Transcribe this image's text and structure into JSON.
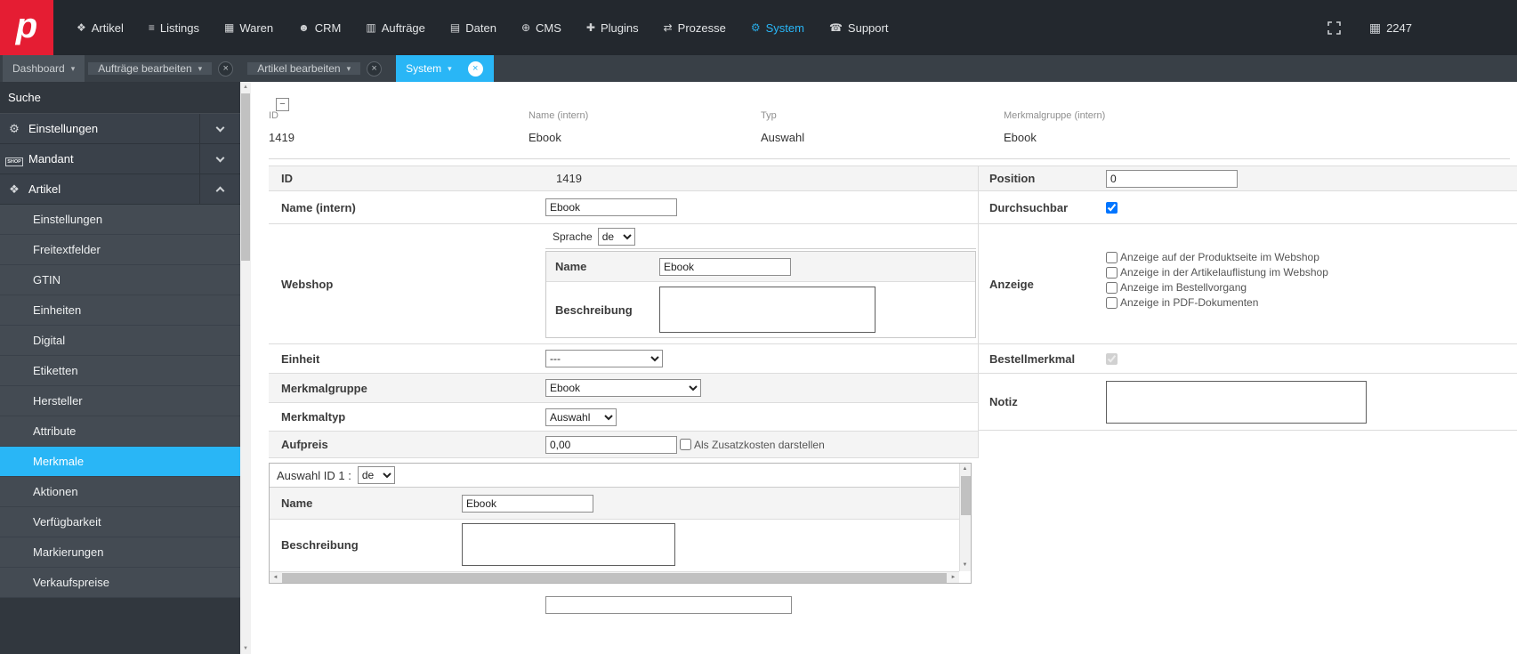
{
  "colors": {
    "accent": "#29b6f6",
    "logo_red": "#e51d33",
    "nav_bg": "#23282e"
  },
  "topnav": {
    "logo_letter": "p",
    "counter": "2247",
    "items": [
      {
        "label": "Artikel",
        "glyph": "❖"
      },
      {
        "label": "Listings",
        "glyph": "≡"
      },
      {
        "label": "Waren",
        "glyph": "▦"
      },
      {
        "label": "CRM",
        "glyph": "☻"
      },
      {
        "label": "Aufträge",
        "glyph": "▥"
      },
      {
        "label": "Daten",
        "glyph": "▤"
      },
      {
        "label": "CMS",
        "glyph": "⊕"
      },
      {
        "label": "Plugins",
        "glyph": "✚"
      },
      {
        "label": "Prozesse",
        "glyph": "⇄"
      },
      {
        "label": "System",
        "glyph": "⚙"
      },
      {
        "label": "Support",
        "glyph": "☎"
      }
    ]
  },
  "tabbar": {
    "caret": "▾",
    "close_glyph": "×",
    "tabs": [
      {
        "label": "Dashboard"
      },
      {
        "label": "Aufträge bearbeiten"
      },
      {
        "label": "Artikel bearbeiten"
      },
      {
        "label": "System"
      }
    ]
  },
  "sidebar": {
    "search_label": "Suche",
    "groups": [
      {
        "label": "Einstellungen",
        "glyph": "⚙"
      },
      {
        "label": "Mandant",
        "icon_text": "SHOP"
      },
      {
        "label": "Artikel",
        "glyph": "❖"
      }
    ],
    "items": [
      "Einstellungen",
      "Freitextfelder",
      "GTIN",
      "Einheiten",
      "Digital",
      "Etiketten",
      "Hersteller",
      "Attribute",
      "Merkmale",
      "Aktionen",
      "Verfügbarkeit",
      "Markierungen",
      "Verkaufspreise"
    ],
    "active_item": "Merkmale"
  },
  "main": {
    "collapse_glyph": "−",
    "summary": {
      "cols": [
        {
          "label": "ID",
          "value": "1419"
        },
        {
          "label": "Name (intern)",
          "value": "Ebook"
        },
        {
          "label": "Typ",
          "value": "Auswahl"
        },
        {
          "label": "Merkmalgruppe (intern)",
          "value": "Ebook"
        }
      ]
    },
    "form": {
      "id": {
        "label": "ID",
        "value": "1419"
      },
      "position": {
        "label": "Position",
        "value": "0"
      },
      "name": {
        "label": "Name (intern)",
        "value": "Ebook"
      },
      "durchsuchbar": {
        "label": "Durchsuchbar",
        "checked": true
      },
      "webshop": {
        "label": "Webshop",
        "sprache_label": "Sprache",
        "sprache_value": "de",
        "name_label": "Name",
        "name_value": "Ebook",
        "beschreibung_label": "Beschreibung"
      },
      "anzeige": {
        "label": "Anzeige",
        "options": [
          "Anzeige auf der Produktseite im Webshop",
          "Anzeige in der Artikelauflistung im Webshop",
          "Anzeige im Bestellvorgang",
          "Anzeige in PDF-Dokumenten"
        ]
      },
      "einheit": {
        "label": "Einheit",
        "value": "---"
      },
      "bestellmerkmal": {
        "label": "Bestellmerkmal",
        "checked": true
      },
      "merkmalgruppe": {
        "label": "Merkmalgruppe",
        "value": "Ebook"
      },
      "notiz": {
        "label": "Notiz"
      },
      "merkmaltyp": {
        "label": "Merkmaltyp",
        "value": "Auswahl"
      },
      "aufpreis": {
        "label": "Aufpreis",
        "value": "0,00",
        "zusatz_label": "Als Zusatzkosten darstellen"
      },
      "auswahl": {
        "header": "Auswahl ID 1 :",
        "lang": "de",
        "name_label": "Name",
        "name_value": "Ebook",
        "beschreibung_label": "Beschreibung"
      }
    }
  },
  "scroll": {
    "up": "▲",
    "down": "▼",
    "left": "◄",
    "right": "►"
  }
}
